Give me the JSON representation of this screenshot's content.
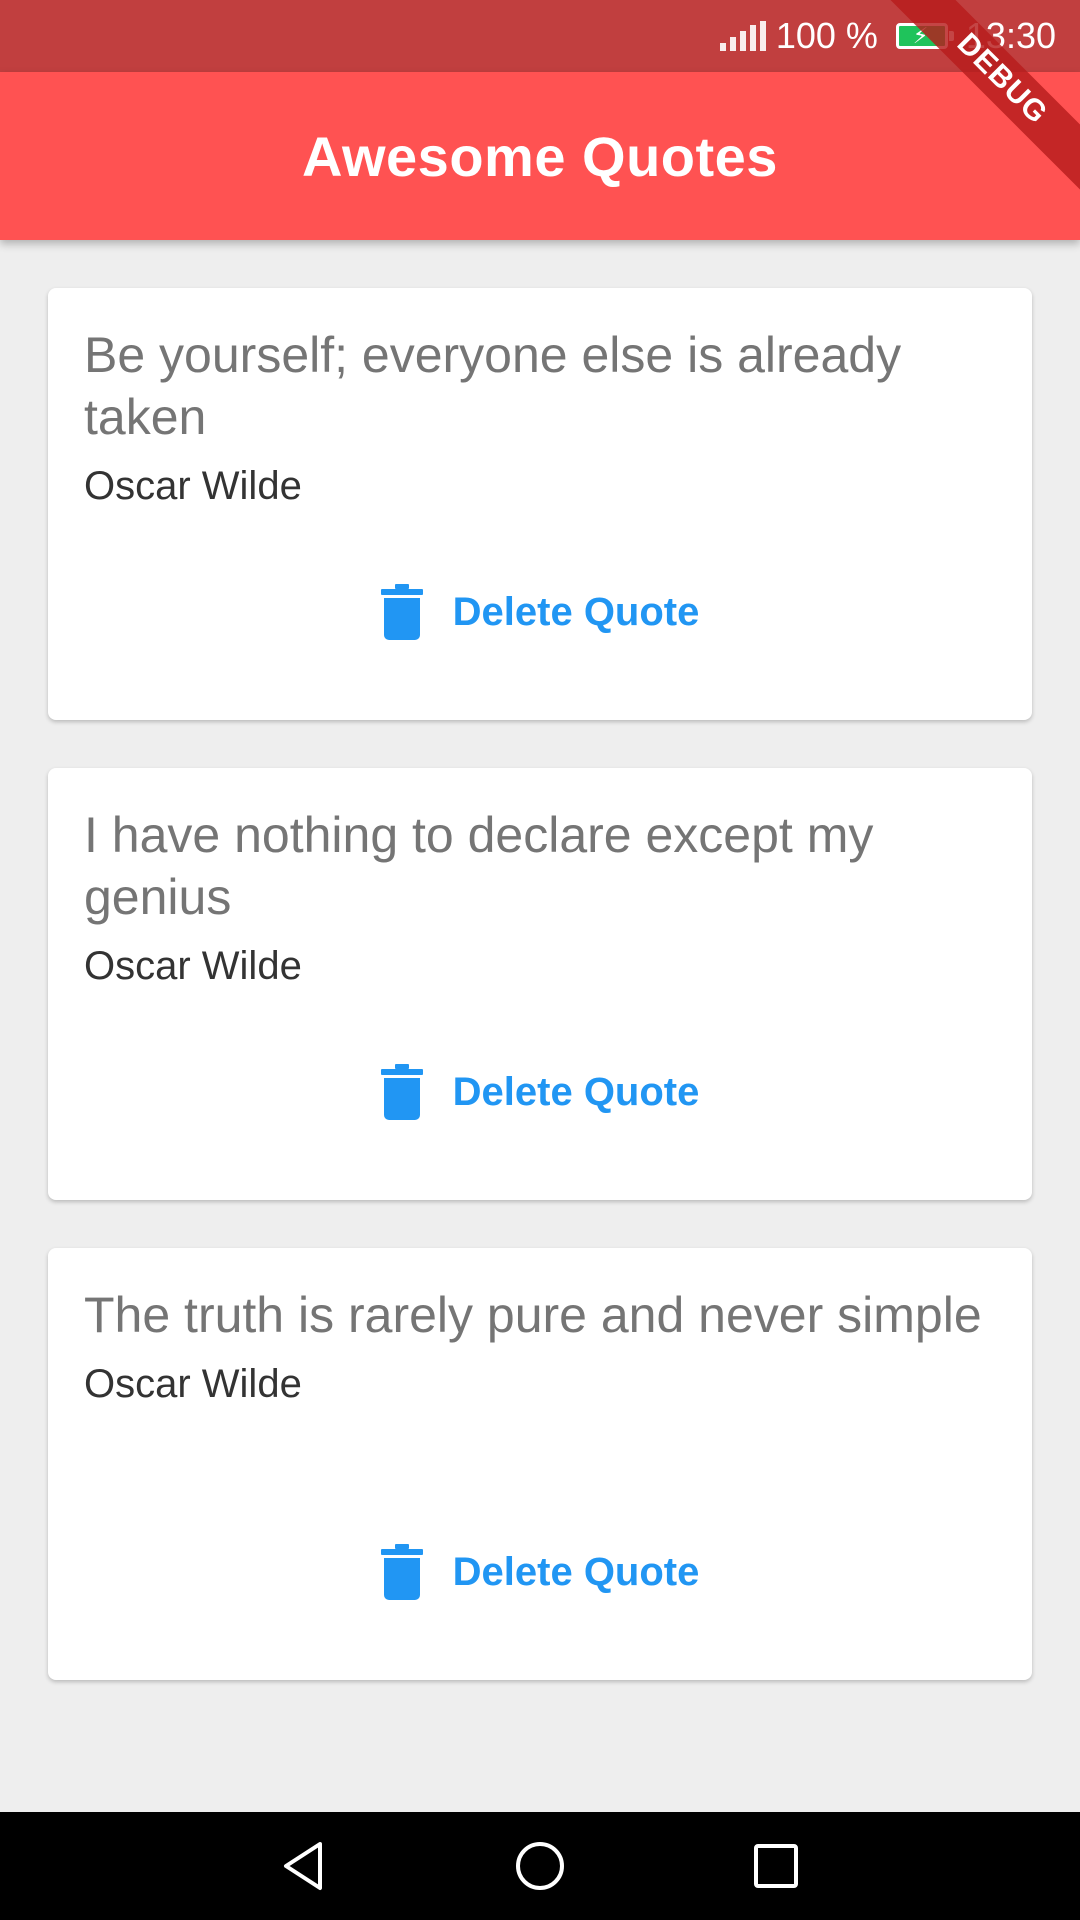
{
  "status_bar": {
    "battery_percent": "100 %",
    "time": "13:30",
    "icons": [
      "signal-icon",
      "battery-charging-icon"
    ]
  },
  "debug_banner": "DEBUG",
  "app_bar": {
    "title": "Awesome Quotes",
    "color": "#ff5252"
  },
  "quotes": [
    {
      "text": "Be yourself; everyone else is already taken",
      "author": "Oscar Wilde",
      "delete_label": "Delete Quote"
    },
    {
      "text": "I have nothing to declare except my genius",
      "author": "Oscar Wilde",
      "delete_label": "Delete Quote"
    },
    {
      "text": "The truth is rarely pure and never simple",
      "author": "Oscar Wilde",
      "delete_label": "Delete Quote"
    }
  ],
  "colors": {
    "accent": "#2196f3",
    "status_bar": "#c13f3f",
    "background": "#eeeeee"
  },
  "nav_bar": {
    "icons": [
      "back-icon",
      "home-icon",
      "recents-icon"
    ]
  }
}
